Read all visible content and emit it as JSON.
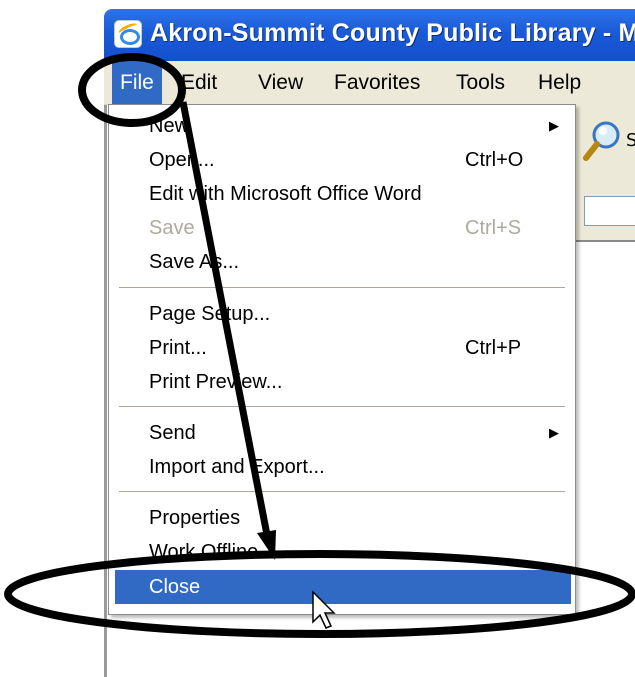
{
  "window": {
    "title": "Akron-Summit County Public Library - M"
  },
  "menubar": {
    "items": [
      "File",
      "Edit",
      "View",
      "Favorites",
      "Tools",
      "Help"
    ]
  },
  "file_menu": {
    "items": [
      {
        "label": "New",
        "submenu": true
      },
      {
        "label": "Open...",
        "shortcut": "Ctrl+O"
      },
      {
        "label": "Edit with Microsoft Office Word"
      },
      {
        "label": "Save",
        "shortcut": "Ctrl+S",
        "disabled": true
      },
      {
        "label": "Save As..."
      },
      {
        "label": "Page Setup..."
      },
      {
        "label": "Print...",
        "shortcut": "Ctrl+P"
      },
      {
        "label": "Print Preview..."
      },
      {
        "label": "Send",
        "submenu": true
      },
      {
        "label": "Import and Export..."
      },
      {
        "label": "Properties"
      },
      {
        "label": "Work Offline"
      },
      {
        "label": "Close",
        "highlighted": true
      }
    ],
    "submenu_arrow": "▶"
  },
  "toolbar": {
    "icon": "search-icon",
    "partial_text": "S"
  },
  "annotations": {
    "style": "black-circle-and-arrow",
    "targets": [
      "File",
      "Close"
    ]
  },
  "colors": {
    "titlebar": "#1a5ad8",
    "highlight": "#316ac5",
    "menubar": "#ece9d8",
    "disabled": "#adaaa1"
  }
}
